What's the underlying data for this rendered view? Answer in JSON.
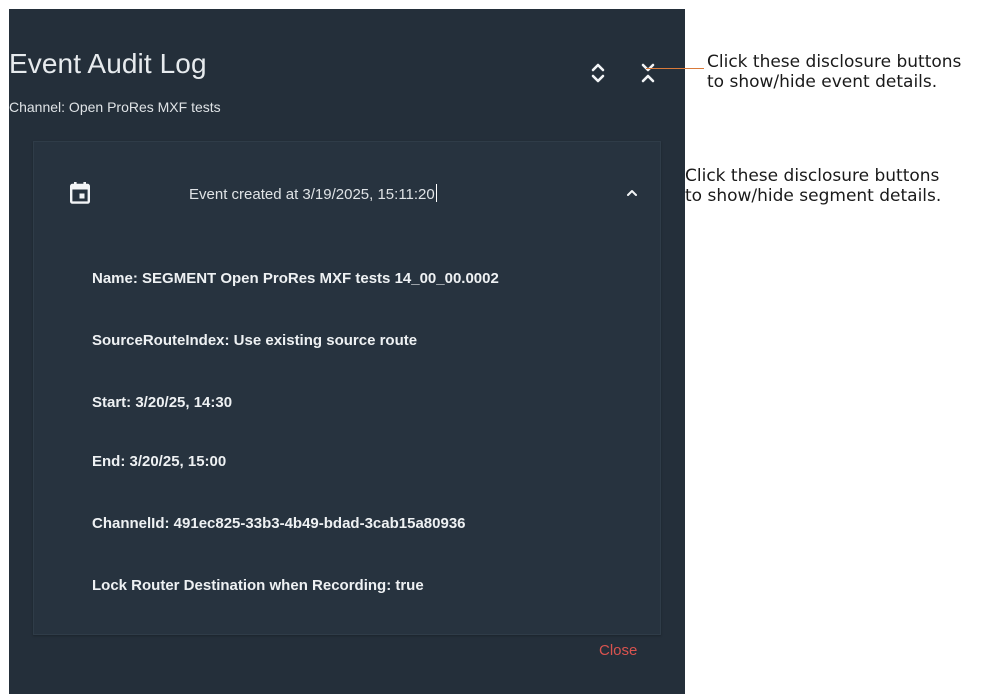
{
  "dialog": {
    "title": "Event Audit Log",
    "subtitle": "Channel: Open ProRes MXF tests",
    "expand_all_icon": "chevrons-expand-icon",
    "collapse_all_icon": "chevrons-collapse-icon",
    "close_label": "Close"
  },
  "segment": {
    "icon": "calendar-icon",
    "header": "Event created at 3/19/2025, 15:11:20",
    "toggle_icon": "chevron-up-icon",
    "details": [
      "Name: SEGMENT Open ProRes MXF tests 14_00_00.0002",
      "SourceRouteIndex: Use existing source route",
      "Start: 3/20/25, 14:30",
      "End: 3/20/25, 15:00",
      "ChannelId: 491ec825-33b3-4b49-bdad-3cab15a80936",
      "Lock Router Destination when Recording: true"
    ]
  },
  "annotations": {
    "event_buttons": {
      "line1": "Click these disclosure buttons",
      "line2": "to show/hide event details."
    },
    "segment_buttons": {
      "line1": "Click these disclosure buttons",
      "line2": "to show/hide segment details."
    }
  },
  "colors": {
    "panel_bg": "#242f3a",
    "segment_bg": "#27333f",
    "text": "#e8ecef",
    "close_accent": "#d9534f",
    "callout_line": "#d97a3a"
  }
}
